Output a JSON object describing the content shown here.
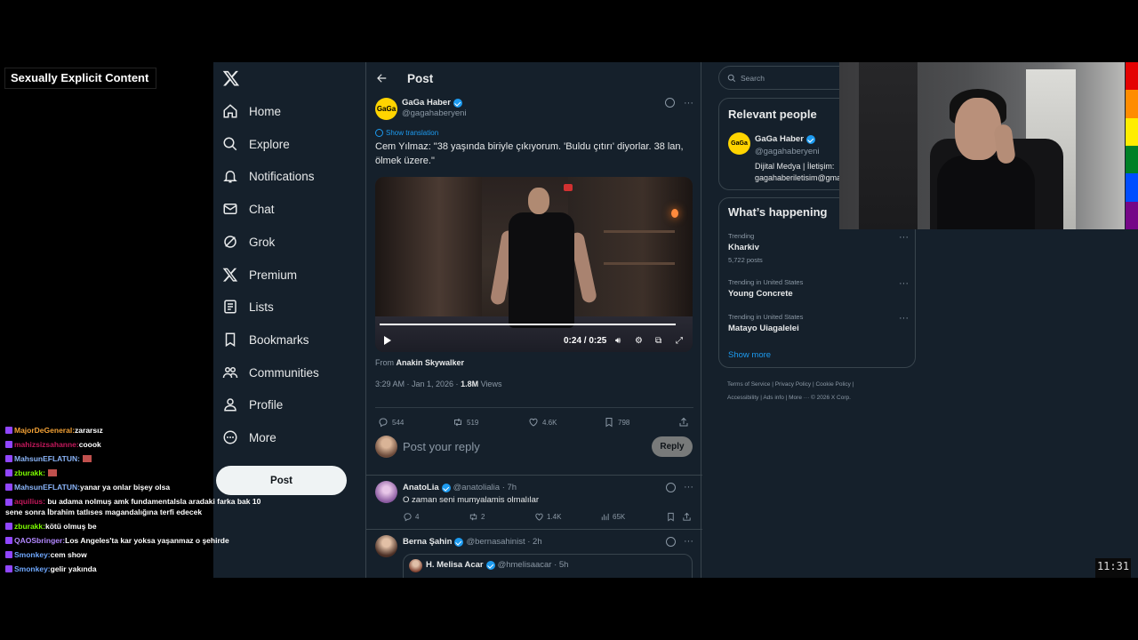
{
  "overlay": {
    "nsfw_label": "Sexually Explicit Content",
    "clock": "11:31"
  },
  "chat": [
    {
      "user": "MajorDeGeneral:",
      "color": "#f4a236",
      "text": "zararsız"
    },
    {
      "user": "mahizsizsahanne:",
      "color": "#c2185b",
      "text": "coook"
    },
    {
      "user": "MahsunEFLATUN:",
      "color": "#8ab4f8",
      "text": ""
    },
    {
      "user": "zburakk:",
      "color": "#7cfc00",
      "text": ""
    },
    {
      "user": "MahsunEFLATUN:",
      "color": "#8ab4f8",
      "text": "yanar ya onlar bişey olsa"
    },
    {
      "user": "aquilius:",
      "color": "#c2185b",
      "text": "bu adama nolmuş amk fundamentalsla aradaki farka bak 10 sene sonra İbrahim tatlıses magandalığına terfi edecek"
    },
    {
      "user": "zburakk:",
      "color": "#7cfc00",
      "text": "kötü olmuş be"
    },
    {
      "user": "QAOSbringer:",
      "color": "#b388ff",
      "text": "Los Angeles'ta kar yoksa yaşanmaz o şehirde"
    },
    {
      "user": "Smonkey:",
      "color": "#6fa8ff",
      "text": "cem show"
    },
    {
      "user": "Smonkey:",
      "color": "#6fa8ff",
      "text": "gelir yakında"
    }
  ],
  "nav": {
    "items": [
      {
        "label": "Home",
        "icon": "home-icon"
      },
      {
        "label": "Explore",
        "icon": "search-icon"
      },
      {
        "label": "Notifications",
        "icon": "bell-icon"
      },
      {
        "label": "Chat",
        "icon": "mail-icon"
      },
      {
        "label": "Grok",
        "icon": "grok-icon"
      },
      {
        "label": "Premium",
        "icon": "x-icon"
      },
      {
        "label": "Lists",
        "icon": "list-icon"
      },
      {
        "label": "Bookmarks",
        "icon": "bookmark-icon"
      },
      {
        "label": "Communities",
        "icon": "communities-icon"
      },
      {
        "label": "Profile",
        "icon": "profile-icon"
      },
      {
        "label": "More",
        "icon": "more-icon"
      }
    ],
    "post_label": "Post"
  },
  "header": {
    "title": "Post"
  },
  "tweet": {
    "author_name": "GaGa Haber",
    "author_handle": "@gagahaberyeni",
    "avatar_text": "GaGa",
    "show_translation": "Show translation",
    "text": "Cem Yılmaz:  \"38 yaşında biriyle çıkıyorum. 'Buldu çıtırı' diyorlar. 38 lan, ölmek üzere.\"",
    "video_time": "0:24 / 0:25",
    "video_progress": 0.96,
    "from_prefix": "From",
    "from_name": "Anakin Skywalker",
    "timestamp": "3:29 AM · Jan 1, 2026 · ",
    "views_count": "1.8M",
    "views_label": "Views",
    "replies": "544",
    "reposts": "519",
    "likes": "4.6K",
    "bookmarks": "798"
  },
  "reply_box": {
    "placeholder": "Post your reply",
    "button": "Reply"
  },
  "replies": [
    {
      "name": "AnatoLia",
      "handle": "@anatolialia · 7h",
      "text": "O zaman seni mumyalamis olmalılar",
      "replies": "4",
      "reposts": "2",
      "likes": "1.4K",
      "views": "65K"
    },
    {
      "name": "Berna Şahin",
      "handle": "@bernasahinist · 2h",
      "quote_name": "H. Melisa Acar",
      "quote_handle": "@hmelisaacar · 5h"
    }
  ],
  "right": {
    "search_placeholder": "Search",
    "relevant_title": "Relevant people",
    "person_name": "GaGa Haber",
    "person_handle": "@gagahaberyeni",
    "person_bio_1": "Dijital Medya | İletişim:",
    "person_bio_2": "gagahaberiletisim@gmail.com",
    "happening_title": "What’s happening",
    "trends": [
      {
        "context": "Trending",
        "title": "Kharkiv",
        "count": "5,722 posts"
      },
      {
        "context": "Trending in United States",
        "title": "Young Concrete",
        "count": ""
      },
      {
        "context": "Trending in United States",
        "title": "Matayo Uiagalelei",
        "count": ""
      }
    ],
    "show_more": "Show more",
    "footer_line1": "Terms of Service  |  Privacy Policy  |  Cookie Policy  |",
    "footer_line2": "Accessibility  |  Ads info  |  More ···  © 2026 X Corp."
  },
  "colors": {
    "accent": "#1d9bf0",
    "background": "#15202b",
    "border": "#38444d",
    "rainbow": [
      "#e40303",
      "#ff8c00",
      "#ffed00",
      "#008026",
      "#004dff",
      "#750787"
    ]
  }
}
